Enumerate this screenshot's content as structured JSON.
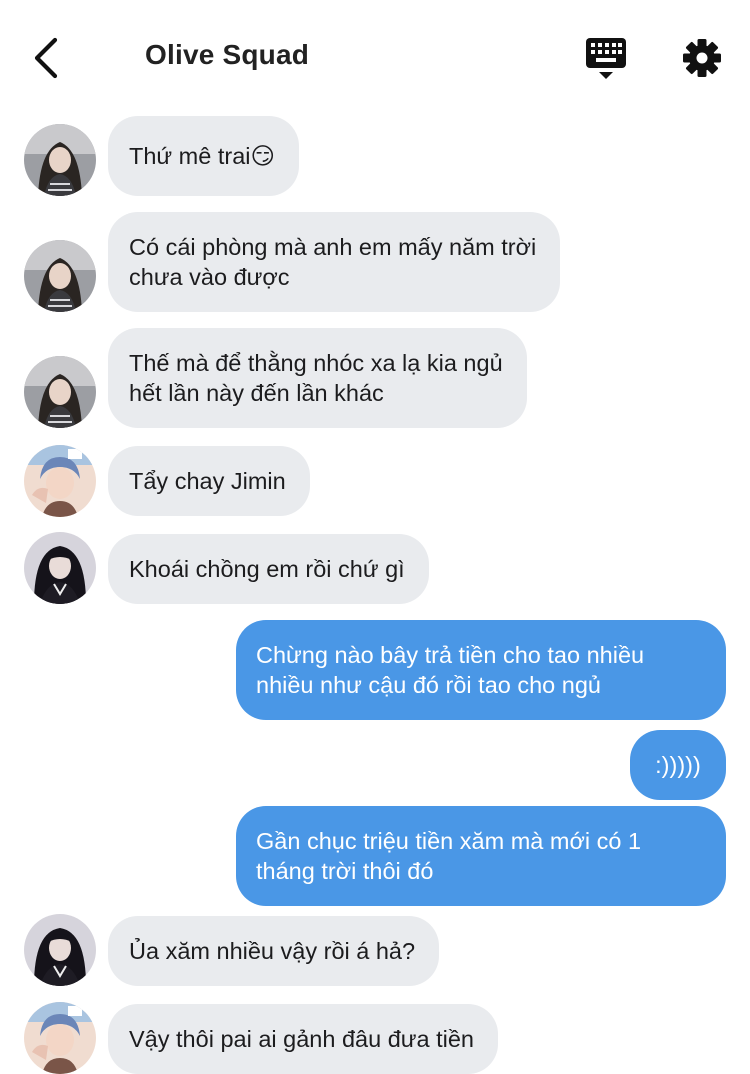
{
  "header": {
    "title": "Olive Squad",
    "back_icon": "chevron-left-icon",
    "keyboard_icon": "keyboard-hide-icon",
    "settings_icon": "gear-icon"
  },
  "colors": {
    "incoming_bubble": "#e9ebee",
    "outgoing_bubble": "#4a97e6",
    "outgoing_text": "#ffffff"
  },
  "messages": [
    {
      "sender": "avatar-girl-long-hair",
      "direction": "in",
      "text": "Thứ mê trai😏"
    },
    {
      "sender": "avatar-girl-long-hair",
      "direction": "in",
      "text": "Có cái phòng mà anh em mấy năm trời\nchưa vào được"
    },
    {
      "sender": "avatar-girl-long-hair",
      "direction": "in",
      "text": "Thế mà để thằng nhóc xa lạ kia ngủ\nhết lần này đến lần khác"
    },
    {
      "sender": "avatar-boy-blue",
      "direction": "in",
      "text": "Tẩy chay Jimin"
    },
    {
      "sender": "avatar-girl-dark",
      "direction": "in",
      "text": "Khoái chồng em rồi chứ gì"
    },
    {
      "sender": "me",
      "direction": "out",
      "text": "Chừng nào bây trả tiền cho tao nhiều\nnhiều như cậu đó rồi tao cho ngủ"
    },
    {
      "sender": "me",
      "direction": "out",
      "text": ":)))))"
    },
    {
      "sender": "me",
      "direction": "out",
      "text": "Gần chục triệu tiền xăm mà mới có 1\ntháng trời thôi đó"
    },
    {
      "sender": "avatar-girl-dark",
      "direction": "in",
      "text": "Ủa xăm nhiều vậy rồi á hả?"
    },
    {
      "sender": "avatar-boy-blue",
      "direction": "in",
      "text": "Vậy thôi pai ai gảnh đâu đưa tiền"
    }
  ]
}
